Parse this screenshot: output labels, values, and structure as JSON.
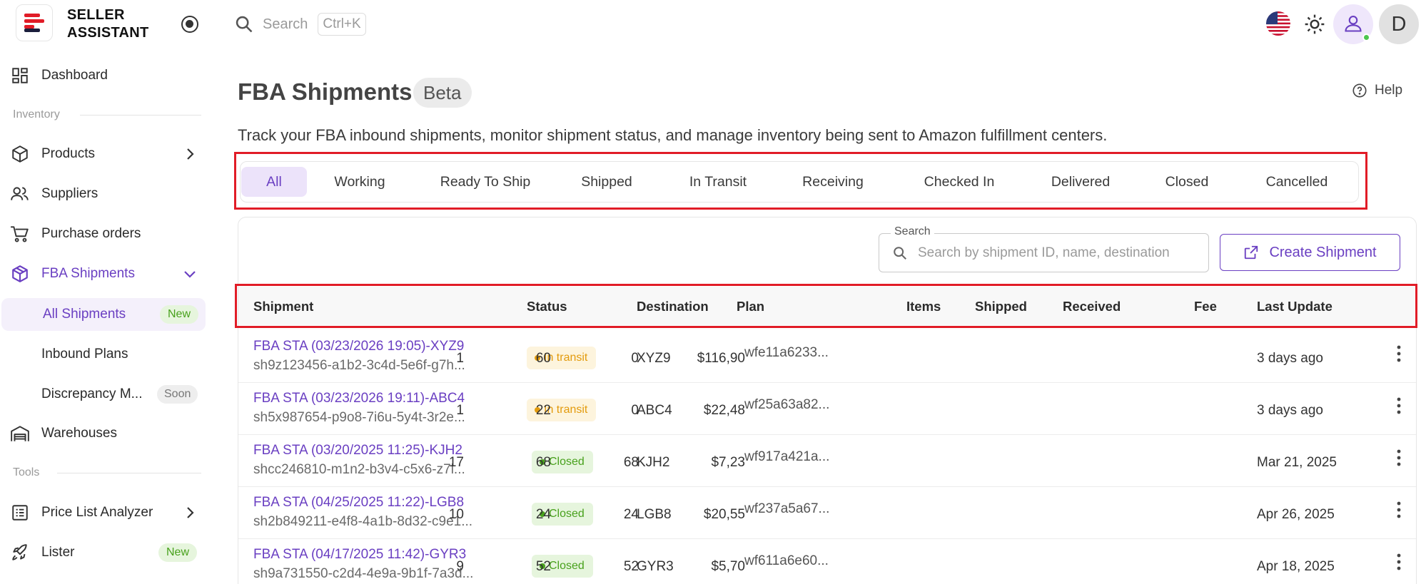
{
  "brand": {
    "name_line1": "SELLER",
    "name_line2": "ASSISTANT"
  },
  "colors": {
    "accent": "#6a3fc2",
    "highlight_red": "#e11c27",
    "success": "#48a11c",
    "warning": "#e39b0d"
  },
  "topbar": {
    "search_placeholder": "Search",
    "search_shortcut": "Ctrl+K",
    "avatar_letter": "D"
  },
  "sidebar": {
    "dashboard": "Dashboard",
    "section_inventory": "Inventory",
    "products": "Products",
    "suppliers": "Suppliers",
    "purchase_orders": "Purchase orders",
    "fba_shipments": "FBA Shipments",
    "all_shipments": "All Shipments",
    "all_shipments_badge": "New",
    "inbound_plans": "Inbound Plans",
    "discrepancy": "Discrepancy M...",
    "discrepancy_badge": "Soon",
    "warehouses": "Warehouses",
    "section_tools": "Tools",
    "price_list_analyzer": "Price List Analyzer",
    "lister": "Lister",
    "lister_badge": "New"
  },
  "header": {
    "title": "FBA Shipments",
    "badge": "Beta",
    "help": "Help",
    "subtitle": "Track your FBA inbound shipments, monitor shipment status, and manage inventory being sent to Amazon fulfillment centers."
  },
  "tabs": [
    "All",
    "Working",
    "Ready To Ship",
    "Shipped",
    "In Transit",
    "Receiving",
    "Checked In",
    "Delivered",
    "Closed",
    "Cancelled"
  ],
  "toolbar": {
    "search_legend": "Search",
    "search_placeholder": "Search by shipment ID, name, destination",
    "create_label": "Create Shipment"
  },
  "table": {
    "headers": {
      "shipment": "Shipment",
      "status": "Status",
      "destination": "Destination",
      "plan": "Plan",
      "items": "Items",
      "shipped": "Shipped",
      "received": "Received",
      "fee": "Fee",
      "last_update": "Last Update"
    },
    "rows": [
      {
        "name": "FBA STA (03/23/2026 19:05)-XYZ9",
        "id": "sh9z123456-a1b2-3c4d-5e6f-g7h...",
        "status": "In transit",
        "destination": "XYZ9",
        "plan": "wfe11a6233...",
        "items": "1",
        "shipped": "60",
        "received": "0",
        "fee": "$116,90",
        "last_update": "3 days ago"
      },
      {
        "name": "FBA STA (03/23/2026 19:11)-ABC4",
        "id": "sh5x987654-p9o8-7i6u-5y4t-3r2e...",
        "status": "In transit",
        "destination": "ABC4",
        "plan": "wf25a63a82...",
        "items": "1",
        "shipped": "22",
        "received": "0",
        "fee": "$22,48",
        "last_update": "3 days ago"
      },
      {
        "name": "FBA STA (03/20/2025 11:25)-KJH2",
        "id": "shcc246810-m1n2-b3v4-c5x6-z7l...",
        "status": "Closed",
        "destination": "KJH2",
        "plan": "wf917a421a...",
        "items": "17",
        "shipped": "68",
        "received": "68",
        "fee": "$7,23",
        "last_update": "Mar 21, 2025"
      },
      {
        "name": "FBA STA (04/25/2025 11:22)-LGB8",
        "id": "sh2b849211-e4f8-4a1b-8d32-c9e1...",
        "status": "Closed",
        "destination": "LGB8",
        "plan": "wf237a5a67...",
        "items": "10",
        "shipped": "24",
        "received": "24",
        "fee": "$20,55",
        "last_update": "Apr 26, 2025"
      },
      {
        "name": "FBA STA (04/17/2025 11:42)-GYR3",
        "id": "sh9a731550-c2d4-4e9a-9b1f-7a3d...",
        "status": "Closed",
        "destination": "GYR3",
        "plan": "wf611a6e60...",
        "items": "9",
        "shipped": "52",
        "received": "52",
        "fee": "$5,70",
        "last_update": "Apr 18, 2025"
      }
    ]
  }
}
